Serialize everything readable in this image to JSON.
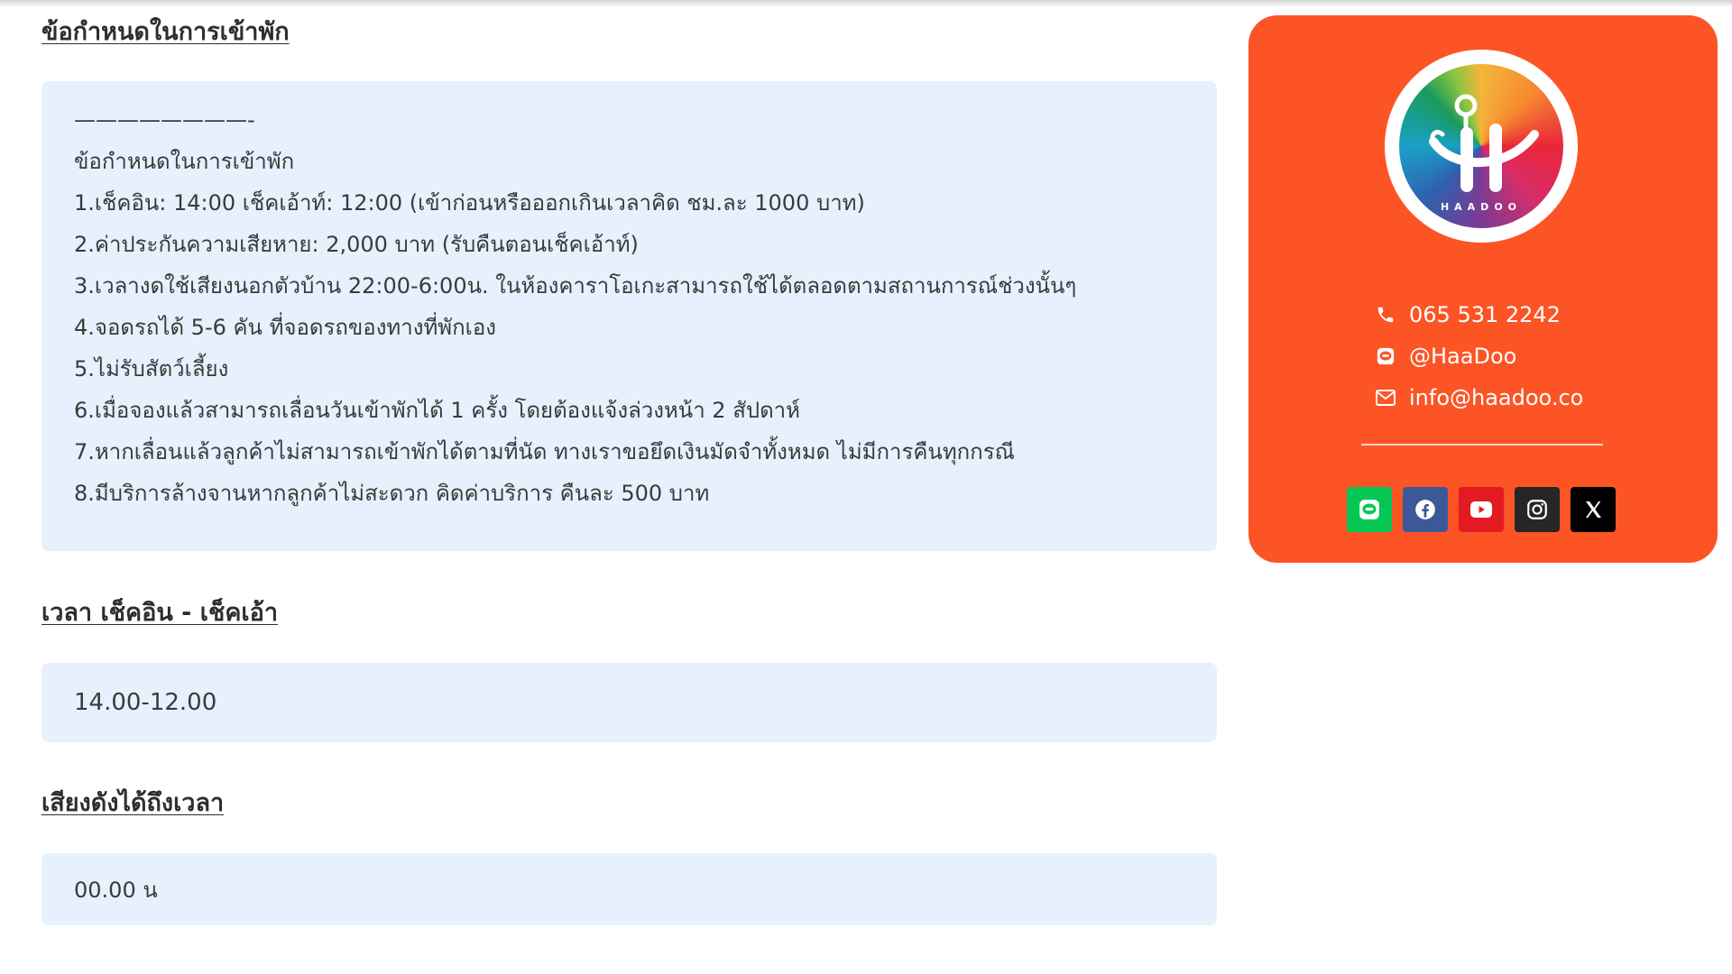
{
  "sections": {
    "rules": {
      "title": "ข้อกำหนดในการเข้าพัก",
      "lines": [
        "————————-",
        "ข้อกำหนดในการเข้าพัก",
        "1.เช็คอิน: 14:00 เช็คเอ้าท์: 12:00 (เข้าก่อนหรือออกเกินเวลาคิด ชม.ละ 1000 บาท)",
        "2.ค่าประกันความเสียหาย: 2,000 บาท (รับคืนตอนเช็คเอ้าท์)",
        "3.เวลางดใช้เสียงนอกตัวบ้าน 22:00-6:00น. ในห้องคาราโอเกะสามารถใช้ได้ตลอดตามสถานการณ์ช่วงนั้นๆ",
        "4.จอดรถได้ 5-6 คัน ที่จอดรถของทางที่พักเอง",
        "5.ไม่รับสัตว์เลี้ยง",
        "6.เมื่อจองแล้วสามารถเลื่อนวันเข้าพักได้ 1 ครั้ง โดยต้องแจ้งล่วงหน้า 2 สัปดาห์",
        "7.หากเลื่อนแล้วลูกค้าไม่สามารถเข้าพักได้ตามที่นัด ทางเราขอยึดเงินมัดจำทั้งหมด ไม่มีการคืนทุกกรณี",
        "8.มีบริการล้างจานหากลูกค้าไม่สะดวก คิดค่าบริการ คืนละ 500 บาท"
      ]
    },
    "checkin": {
      "title": "เวลา เช็คอิน - เช็คเอ้า",
      "value": "14.00-12.00"
    },
    "noise": {
      "title": "เสียงดังได้ถึงเวลา",
      "value": "00.00 น"
    }
  },
  "sidebar": {
    "logo_text": "HAADOO",
    "phone": "065 531 2242",
    "line_id": "@HaaDoo",
    "email": "info@haadoo.co",
    "socials": [
      {
        "name": "line",
        "color": "#06c755",
        "icon": "line-icon"
      },
      {
        "name": "facebook",
        "color": "#3b5998",
        "icon": "facebook-icon"
      },
      {
        "name": "youtube",
        "color": "#e41a23",
        "icon": "youtube-icon"
      },
      {
        "name": "instagram",
        "color": "#262626",
        "icon": "instagram-icon"
      },
      {
        "name": "x",
        "color": "#000000",
        "icon": "x-icon"
      }
    ],
    "accent": "#fc5425"
  }
}
